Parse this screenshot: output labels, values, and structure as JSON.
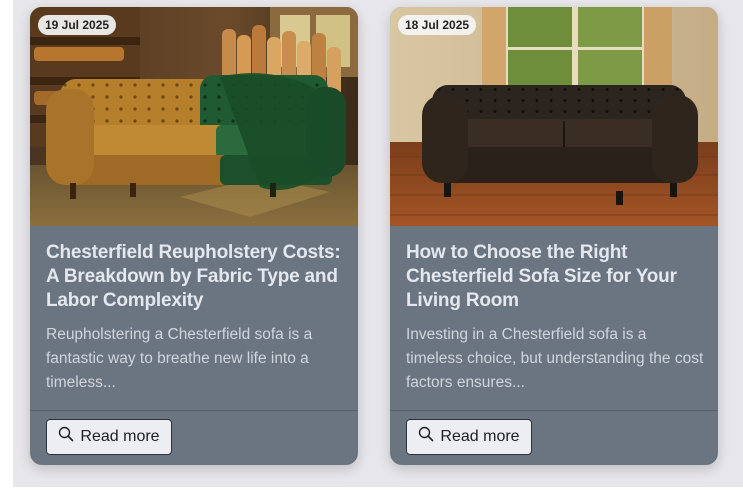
{
  "articles": [
    {
      "date": "19 Jul 2025",
      "title": "Chesterfield Reupholstery Costs: A Breakdown by Fabric Type and Labor Complexity",
      "excerpt": "Reupholstering a Chesterfield sofa is a fantastic way to breathe new life into a timeless...",
      "read_more_label": "Read more",
      "image_icon": "sofa-photo-icon",
      "colors": {
        "sofa_left": "#b8822c",
        "sofa_right": "#1f5a32"
      }
    },
    {
      "date": "18 Jul 2025",
      "title": "How to Choose the Right Chesterfield Sofa Size for Your Living Room",
      "excerpt": "Investing in a Chesterfield sofa is a timeless choice, but understanding the cost factors ensures...",
      "read_more_label": "Read more",
      "image_icon": "sofa-photo-icon",
      "colors": {
        "sofa": "#2a2018"
      }
    }
  ],
  "theme": {
    "card_body": "#6b7582",
    "title_color": "#e4e8ee",
    "excerpt_color": "#d0d5dc",
    "page_panel": "#e7e6ea"
  }
}
